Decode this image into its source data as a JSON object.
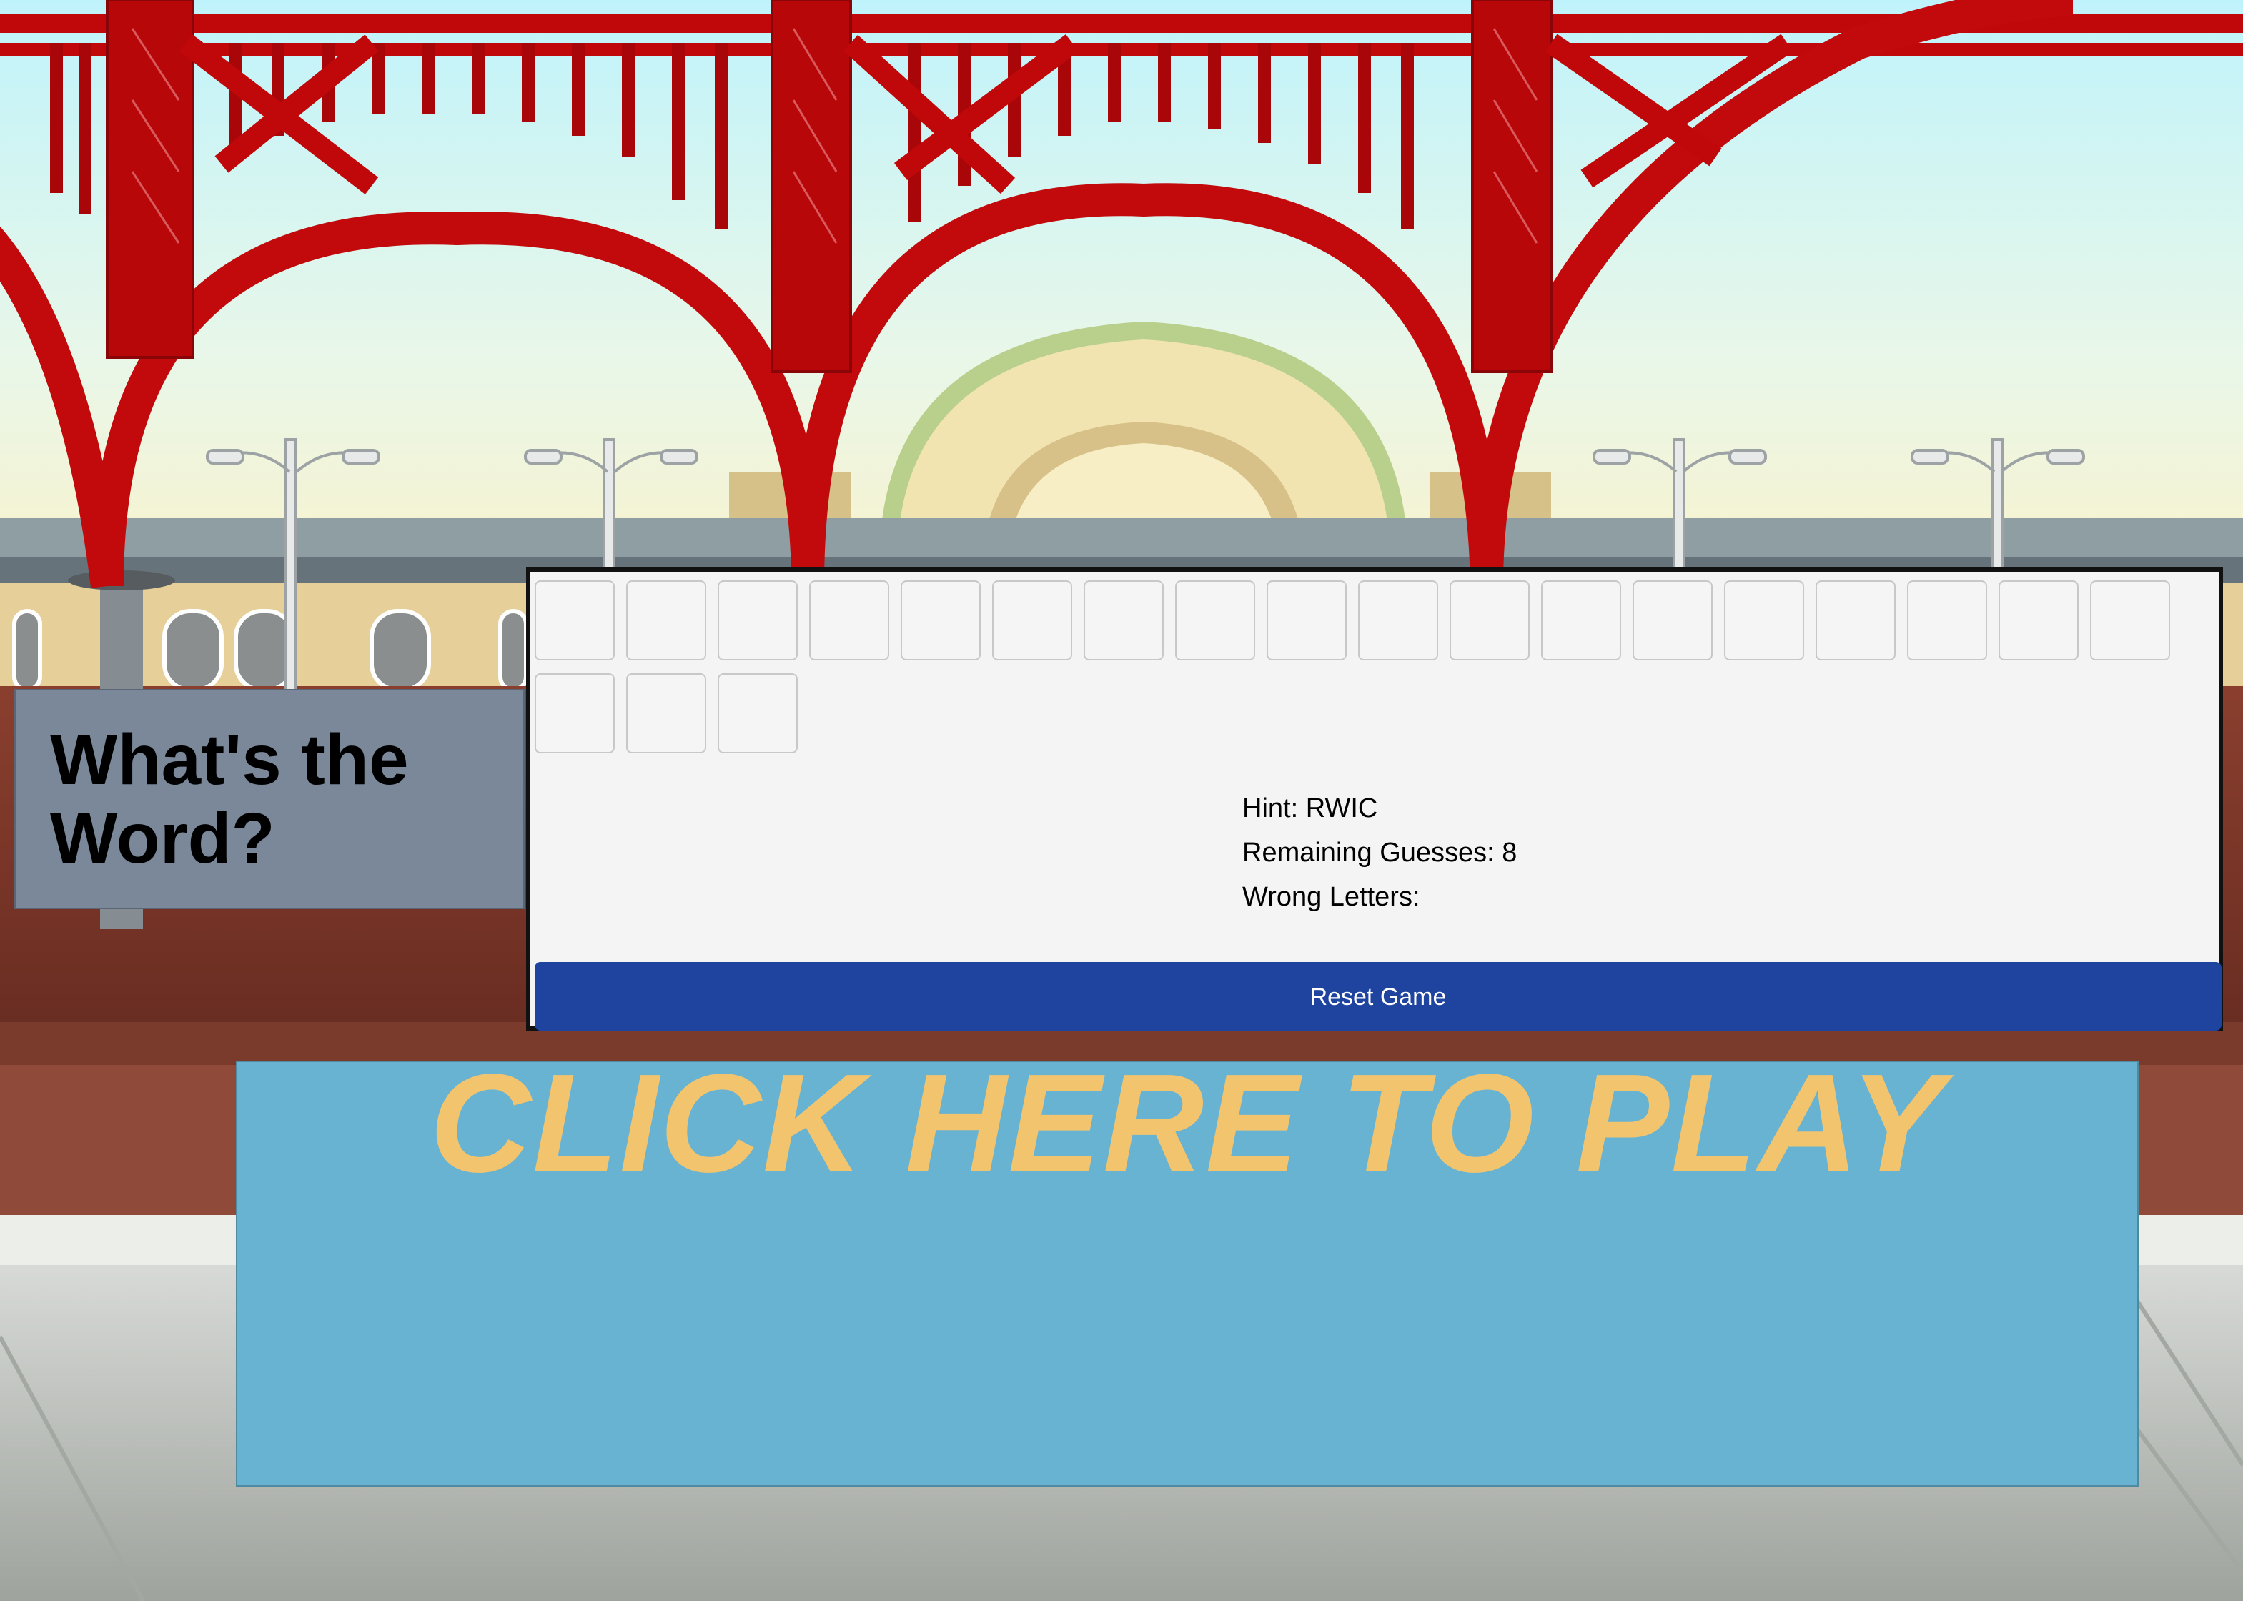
{
  "title": "What's the Word?",
  "tiles": {
    "row1_count": 18,
    "row2_count": 3
  },
  "hint": "Hint: RWIC",
  "remaining_guesses": "Remaining Guesses: 8",
  "wrong_letters": "Wrong Letters:",
  "reset_label": "Reset Game",
  "play_label": "CLICK HERE TO PLAY",
  "colors": {
    "title_panel": "#7a8899",
    "reset_button": "#1e44a0",
    "play_box": "#68b3d2",
    "play_text": "#f3c46e",
    "arch_red": "#c0080a"
  }
}
